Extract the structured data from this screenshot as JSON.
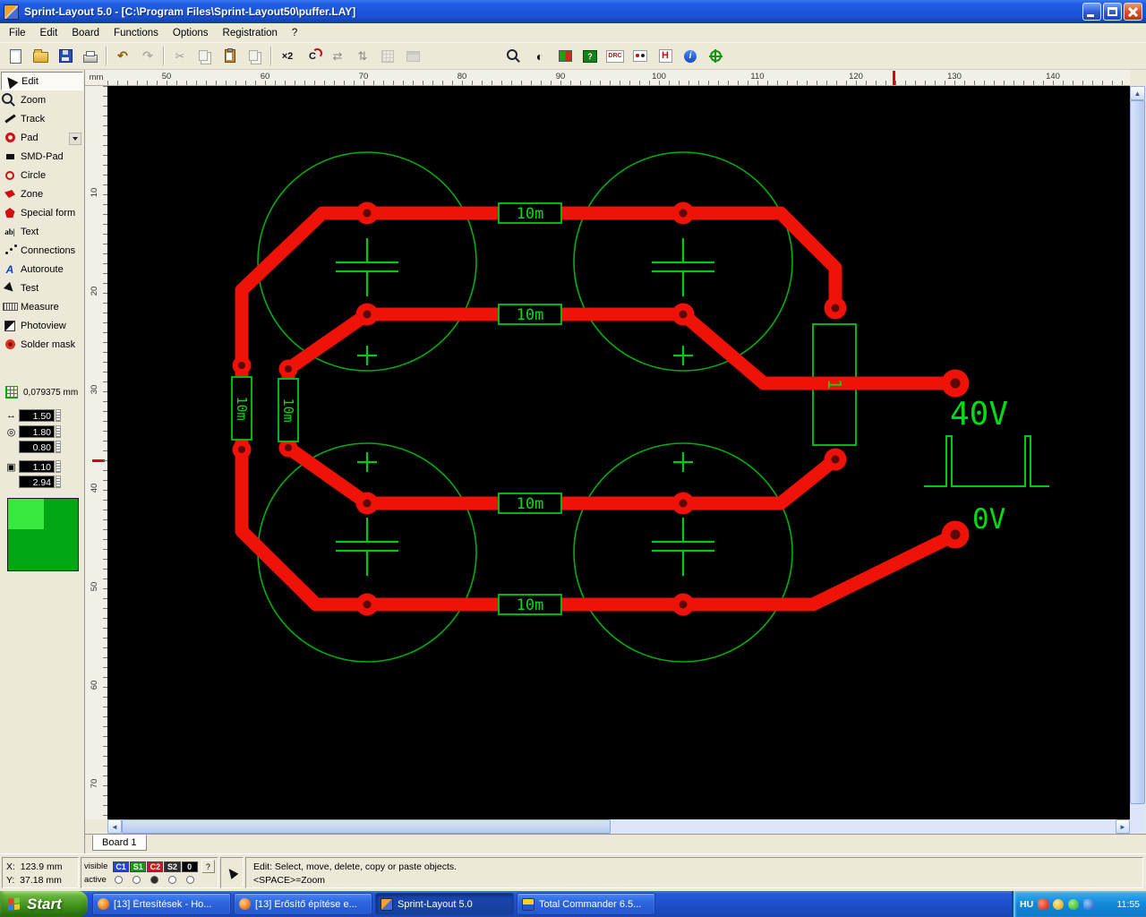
{
  "window": {
    "title": "Sprint-Layout 5.0 - [C:\\Program Files\\Sprint-Layout50\\puffer.LAY]"
  },
  "menu": {
    "items": [
      {
        "label": "File"
      },
      {
        "label": "Edit"
      },
      {
        "label": "Board"
      },
      {
        "label": "Functions"
      },
      {
        "label": "Options"
      },
      {
        "label": "Registration"
      },
      {
        "label": "?"
      }
    ]
  },
  "toolbar": {
    "items": [
      {
        "name": "new"
      },
      {
        "name": "open"
      },
      {
        "name": "save"
      },
      {
        "name": "print"
      },
      {
        "name": "undo"
      },
      {
        "name": "redo"
      },
      {
        "name": "cut"
      },
      {
        "name": "copy"
      },
      {
        "name": "paste"
      },
      {
        "name": "duplicate"
      },
      {
        "name": "scale-x2"
      },
      {
        "name": "rotate"
      },
      {
        "name": "mirror-horizontal"
      },
      {
        "name": "mirror-vertical"
      },
      {
        "name": "align-grid"
      },
      {
        "name": "library"
      },
      {
        "name": "zoom"
      },
      {
        "name": "photoview"
      },
      {
        "name": "layer-colors"
      },
      {
        "name": "check"
      },
      {
        "name": "drc"
      },
      {
        "name": "gerber"
      },
      {
        "name": "hpgl"
      },
      {
        "name": "info"
      },
      {
        "name": "origin"
      }
    ],
    "scale_label": "×2",
    "rotate_label": "C",
    "check_label": "?",
    "drc_label": "DRC",
    "hpgl_label": "H",
    "info_label": "i"
  },
  "tools": {
    "items": [
      {
        "label": "Edit"
      },
      {
        "label": "Zoom"
      },
      {
        "label": "Track"
      },
      {
        "label": "Pad"
      },
      {
        "label": "SMD-Pad"
      },
      {
        "label": "Circle"
      },
      {
        "label": "Zone"
      },
      {
        "label": "Special form"
      },
      {
        "label": "Text",
        "icon_text": "ab|"
      },
      {
        "label": "Connections"
      },
      {
        "label": "Autoroute",
        "icon_text": "A"
      },
      {
        "label": "Test"
      },
      {
        "label": "Measure"
      },
      {
        "label": "Photoview"
      },
      {
        "label": "Solder mask"
      }
    ]
  },
  "grid": {
    "value": "0,079375 mm"
  },
  "params": {
    "track_width": "1.50",
    "pad_outer": "1.80",
    "pad_drill": "0.80",
    "smd_width": "1.10",
    "smd_height": "2.94"
  },
  "icons": {
    "track_width_glyph": "↔",
    "pad_glyph": "◎",
    "smd_glyph": "▣"
  },
  "rulers": {
    "unit": "mm",
    "h": [
      "50",
      "60",
      "70",
      "80",
      "90",
      "100",
      "110",
      "120",
      "130",
      "140"
    ],
    "v": [
      "10",
      "20",
      "30",
      "40",
      "50",
      "60",
      "70"
    ]
  },
  "board": {
    "tab": "Board 1",
    "resistor_label": "10m",
    "component_label": "1",
    "voltage_top": "40V",
    "voltage_bottom": "0V",
    "copper_color": "#EE1208",
    "silkscreen_color": "#00C814"
  },
  "statusbar": {
    "x_readout": "X:  123.9 mm",
    "y_readout": "Y:  37.18 mm",
    "visible_label": "visible",
    "active_label": "active",
    "layers": [
      {
        "label": "C1",
        "color": "#2343e0"
      },
      {
        "label": "S1",
        "color": "#149a14"
      },
      {
        "label": "C2",
        "color": "#d41414"
      },
      {
        "label": "S2",
        "color": "#2e2e2e"
      },
      {
        "label": "0",
        "color": "#000000"
      }
    ],
    "help_label": "?",
    "hint_line1": "Edit: Select, move, delete, copy or paste objects.",
    "hint_line2": "<SPACE>=Zoom"
  },
  "taskbar": {
    "start_label": "Start",
    "tasks": [
      {
        "title": "[13] Értesítések - Ho..."
      },
      {
        "title": "[13] Erősítő építése e..."
      },
      {
        "title": "Sprint-Layout 5.0"
      },
      {
        "title": "Total Commander 6.5..."
      }
    ],
    "language": "HU",
    "time": "11:55"
  }
}
